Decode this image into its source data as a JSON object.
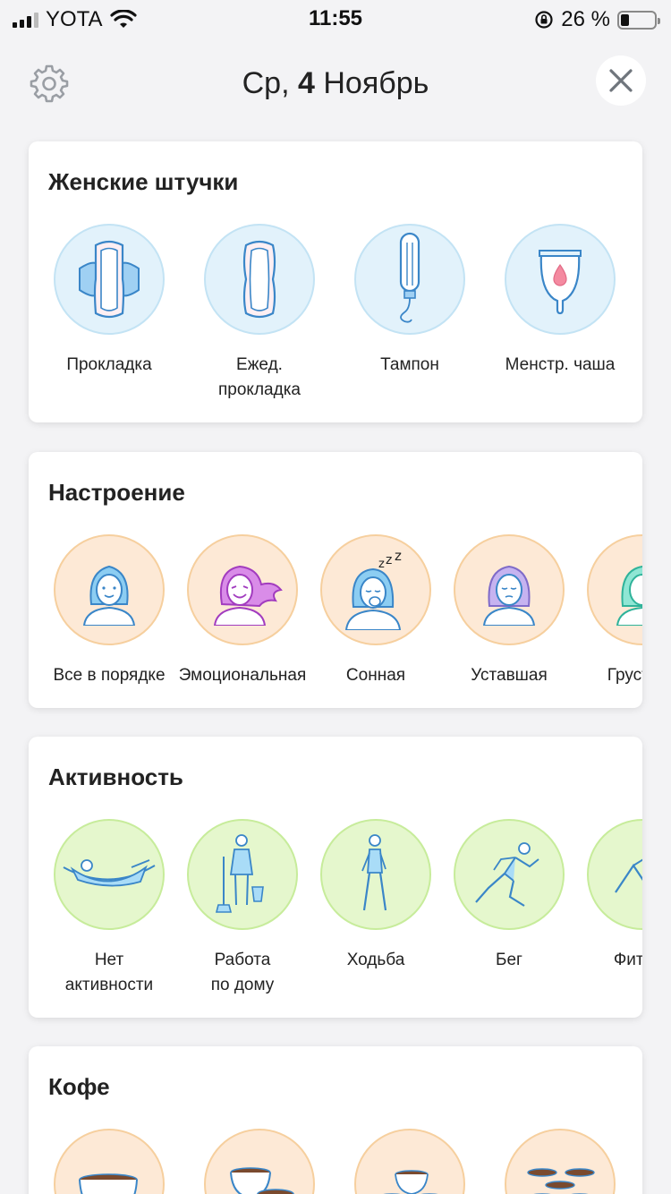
{
  "status": {
    "carrier": "YOTA",
    "time": "11:55",
    "battery_text": "26 %",
    "battery_level": 0.26
  },
  "header": {
    "day": "Ср,",
    "date_number": "4",
    "month": "Ноябрь"
  },
  "sections": {
    "feminine": {
      "title": "Женские штучки",
      "items": [
        "Прокладка",
        "Ежед.\nпрокладка",
        "Тампон",
        "Менстр. чаша"
      ]
    },
    "mood": {
      "title": "Настроение",
      "items": [
        "Все в порядке",
        "Эмоциональная",
        "Сонная",
        "Уставшая",
        "Грустная"
      ]
    },
    "activity": {
      "title": "Активность",
      "items": [
        "Нет\nактивности",
        "Работа\nпо дому",
        "Ходьба",
        "Бег",
        "Фитнес"
      ]
    },
    "coffee": {
      "title": "Кофе"
    }
  },
  "colors": {
    "blue_circle": "#e2f2fb",
    "peach_circle": "#fde9d6",
    "green_circle": "#e5f7cd",
    "icon_blue": "#3a86c8"
  }
}
